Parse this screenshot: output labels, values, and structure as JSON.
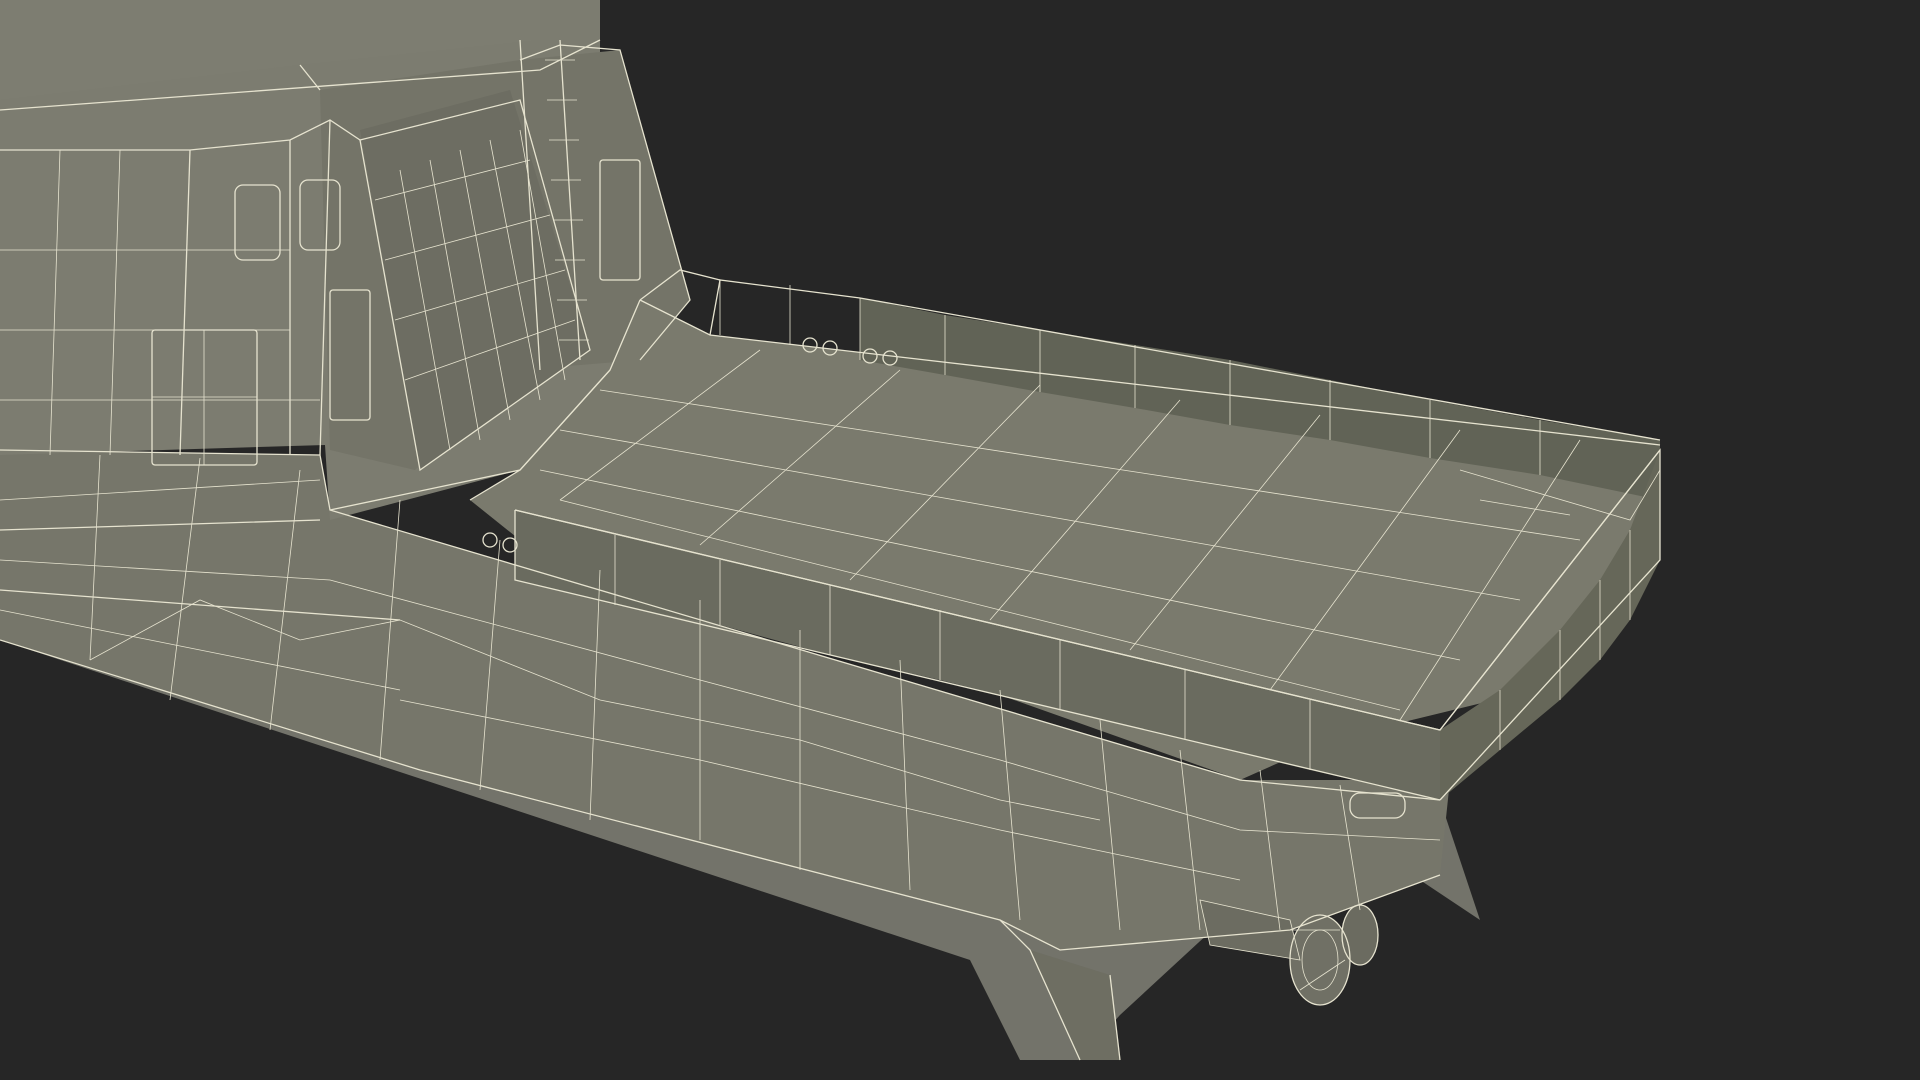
{
  "scene": {
    "subject": "ship-stern-wireframe",
    "background_color": "#262626",
    "hull_color": "#77776a",
    "hull_shade_color": "#6b6b5f",
    "deck_color": "#7a7a6d",
    "wire_color": "#e6e3cf",
    "panel_color": "#616356",
    "bulwark_panel_count": 18,
    "stern_panel_count": 8
  }
}
